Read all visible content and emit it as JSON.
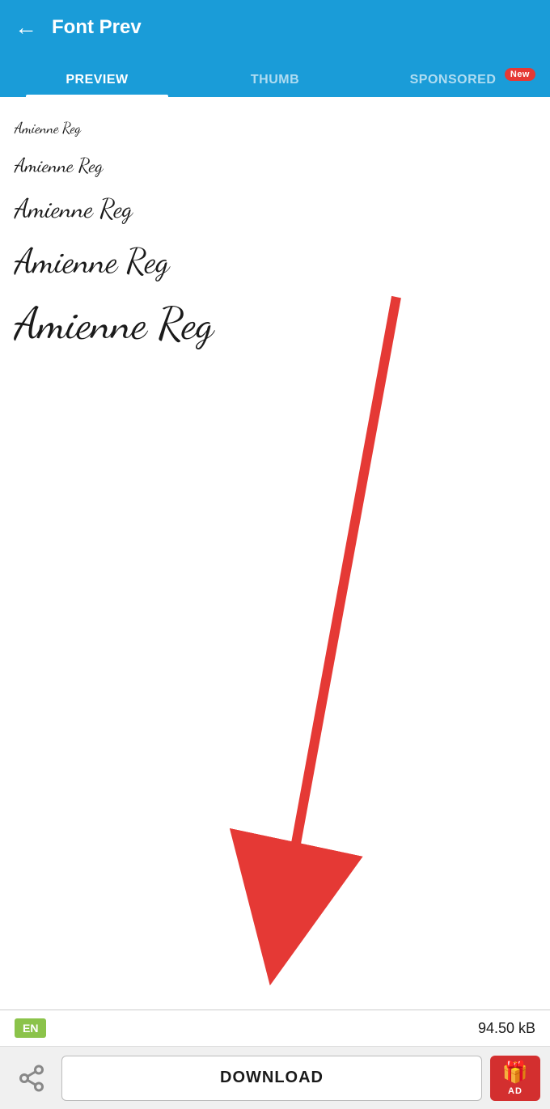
{
  "header": {
    "back_icon": "←",
    "title": "Font Prev"
  },
  "tabs": [
    {
      "id": "preview",
      "label": "PREVIEW",
      "active": true,
      "badge": null
    },
    {
      "id": "thumb",
      "label": "THUMB",
      "active": false,
      "badge": null
    },
    {
      "id": "sponsored",
      "label": "SPONSORED",
      "active": false,
      "badge": "New"
    }
  ],
  "font_name": "Amienne Reg",
  "preview_items": [
    {
      "text": "Amienne Reg",
      "size_class": "size-xs"
    },
    {
      "text": "Amienne Reg",
      "size_class": "size-sm"
    },
    {
      "text": "Amienne Reg",
      "size_class": "size-md"
    },
    {
      "text": "Amienne Reg",
      "size_class": "size-lg"
    },
    {
      "text": "Amienne Reg",
      "size_class": "size-xl"
    }
  ],
  "info_bar": {
    "lang": "EN",
    "file_size": "94.50 kB"
  },
  "bottom_bar": {
    "share_label": "share",
    "download_label": "DOWNLOAD",
    "ad_label": "AD"
  },
  "colors": {
    "header_bg": "#1a9cd8",
    "active_tab": "#ffffff",
    "inactive_tab": "rgba(255,255,255,0.65)",
    "badge_bg": "#e53935",
    "lang_badge_bg": "#8bc34a",
    "gift_btn_bg": "#d32f2f",
    "arrow_color": "#e53935"
  }
}
